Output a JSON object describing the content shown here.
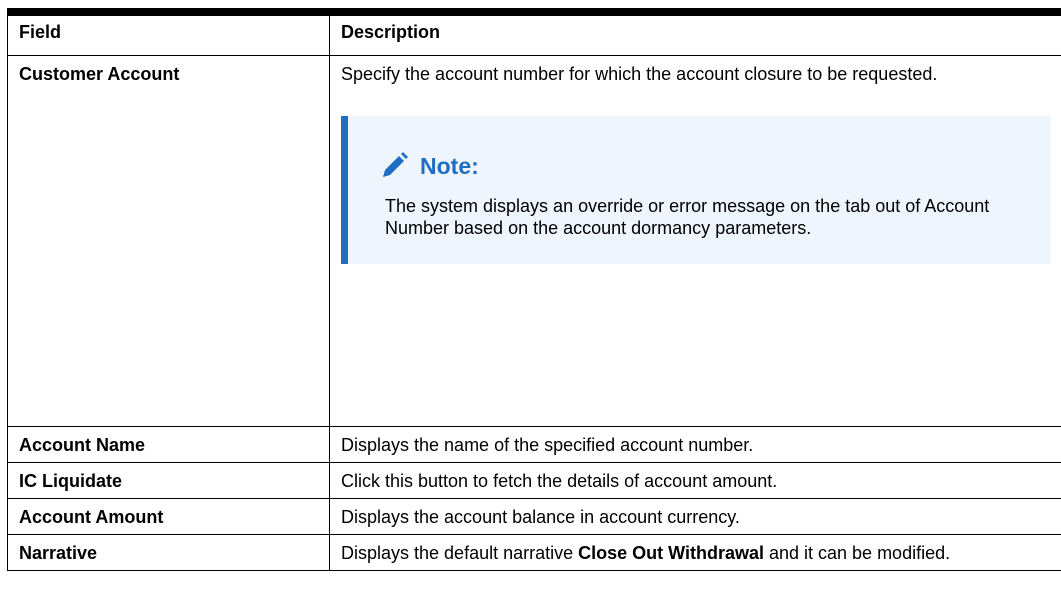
{
  "table": {
    "headers": {
      "field": "Field",
      "description": "Description"
    },
    "rows": {
      "customer_account": {
        "field": "Customer Account",
        "description": "Specify the account number for which the account closure to be requested.",
        "note": {
          "title": "Note:",
          "body": "The system displays an override or error message on the tab out of Account Number based on the account dormancy parameters."
        }
      },
      "account_name": {
        "field": "Account Name",
        "description": "Displays the name of the specified account number."
      },
      "ic_liquidate": {
        "field": "IC Liquidate",
        "description": "Click this button to fetch the details of account amount."
      },
      "account_amount": {
        "field": "Account Amount",
        "description": "Displays the account balance in account currency."
      },
      "narrative": {
        "field": "Narrative",
        "description_prefix": "Displays the default narrative ",
        "description_bold": "Close Out Withdrawal",
        "description_suffix": " and it can be modified."
      }
    }
  },
  "colors": {
    "note_accent": "#1f6ec2",
    "note_background": "#eef5fc"
  },
  "icons": {
    "note": "pencil-icon"
  }
}
